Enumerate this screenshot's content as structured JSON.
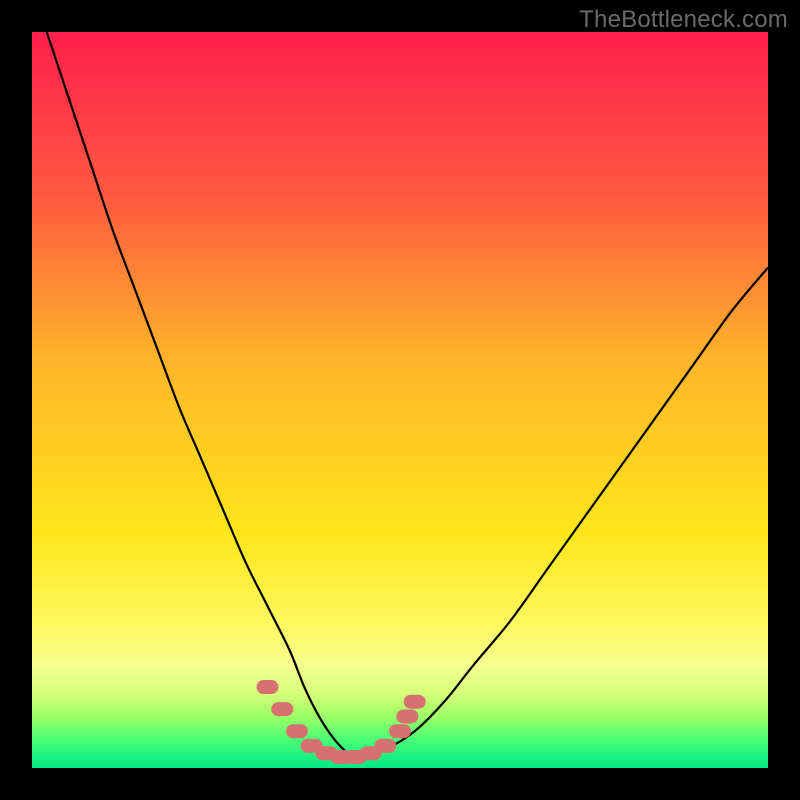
{
  "watermark": "TheBottleneck.com",
  "chart_data": {
    "type": "line",
    "title": "",
    "xlabel": "",
    "ylabel": "",
    "xlim": [
      0,
      100
    ],
    "ylim": [
      0,
      100
    ],
    "grid": false,
    "series": [
      {
        "name": "curve",
        "color": "#000000",
        "x": [
          2,
          5,
          8,
          11,
          14,
          17,
          20,
          23,
          26,
          29,
          32,
          35,
          37,
          39,
          41,
          43,
          45,
          48,
          52,
          56,
          60,
          65,
          70,
          75,
          80,
          85,
          90,
          95,
          100
        ],
        "y": [
          100,
          91,
          82,
          73,
          65,
          57,
          49,
          42,
          35,
          28,
          22,
          16,
          11,
          7,
          4,
          2,
          1.5,
          2.5,
          5,
          9,
          14,
          20,
          27,
          34,
          41,
          48,
          55,
          62,
          68
        ]
      }
    ],
    "markers": {
      "name": "bottom-markers",
      "color": "#d77171",
      "x": [
        32,
        34,
        36,
        38,
        40,
        42,
        44,
        46,
        48,
        50,
        51,
        52
      ],
      "y": [
        11,
        8,
        5,
        3,
        2,
        1.5,
        1.5,
        2,
        3,
        5,
        7,
        9
      ]
    },
    "background_gradient": {
      "stops": [
        {
          "pct": 0,
          "color": "#ff1f4b"
        },
        {
          "pct": 22,
          "color": "#ff5840"
        },
        {
          "pct": 45,
          "color": "#ffb629"
        },
        {
          "pct": 68,
          "color": "#ffe61a"
        },
        {
          "pct": 80,
          "color": "#fff85e"
        },
        {
          "pct": 86,
          "color": "#f6ff8e"
        },
        {
          "pct": 90,
          "color": "#d4ff7a"
        },
        {
          "pct": 93,
          "color": "#9cff66"
        },
        {
          "pct": 96,
          "color": "#4dff74"
        },
        {
          "pct": 100,
          "color": "#00e887"
        }
      ]
    }
  }
}
